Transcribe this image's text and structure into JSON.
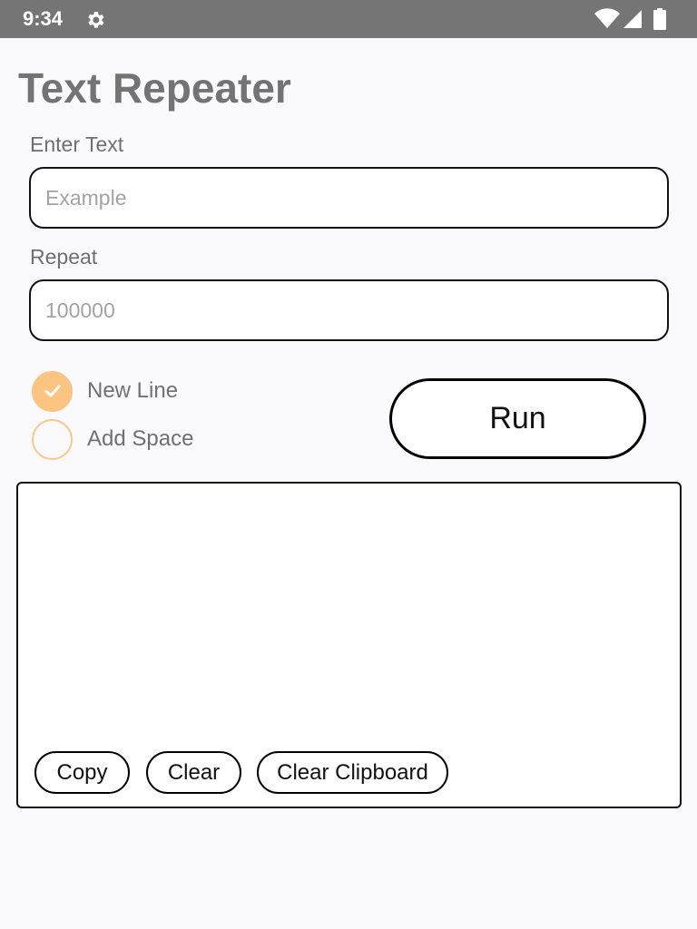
{
  "status_bar": {
    "time": "9:34",
    "icons": [
      "gear-icon",
      "wifi-icon",
      "signal-icon",
      "battery-icon"
    ]
  },
  "app": {
    "title": "Text Repeater"
  },
  "form": {
    "text_label": "Enter Text",
    "text_value": "",
    "text_placeholder": "Example",
    "repeat_label": "Repeat",
    "repeat_value": "",
    "repeat_placeholder": "100000"
  },
  "options": {
    "new_line": {
      "label": "New Line",
      "checked": true
    },
    "add_space": {
      "label": "Add Space",
      "checked": false
    }
  },
  "run_label": "Run",
  "output": {
    "text": "",
    "copy_label": "Copy",
    "clear_label": "Clear",
    "clear_clipboard_label": "Clear Clipboard"
  },
  "colors": {
    "accent": "#fbc481",
    "status_bar": "#757575",
    "background": "#faf9fb"
  }
}
